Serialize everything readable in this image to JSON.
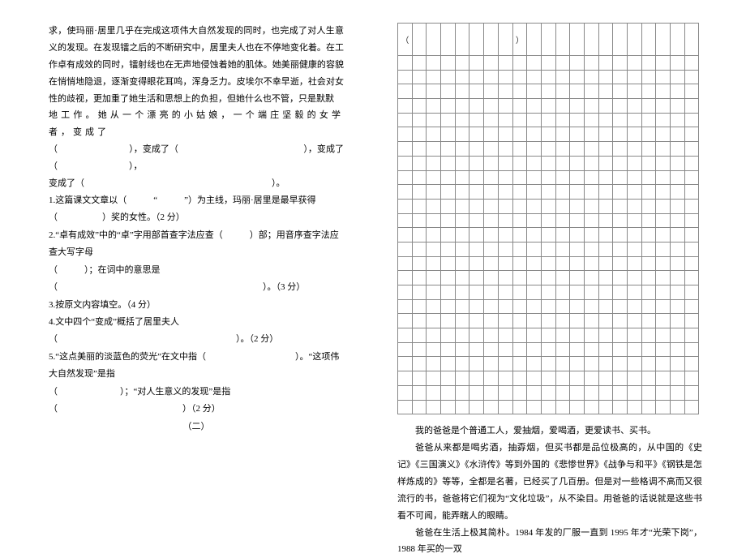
{
  "left": {
    "passage_1": "求，使玛丽·居里几乎在完成这项伟大自然发现的同时，也完成了对人生意义的发现。在发现镭之后的不断研究中，居里夫人也在不停地变化着。在工作卓有成效的同时，镭射线也在无声地侵蚀着她的肌体。她美丽健康的容貌在悄悄地隐退，逐渐变得眼花耳鸣，浑身乏力。皮埃尔不幸早逝，社会对女性的歧视，更加重了她生活和思想上的负担，但她什么也不管，只是默默",
    "passage_2_spaced": "地工作。她从一个漂亮的小姑娘，一个端庄坚毅的女学者，变成了",
    "passage_3": "（　　　　　　　　），变成了（　　　　　　　　　　　　　　），变成了（　　　　　　　　），",
    "passage_4": "变成了（　　　　　　　　　　　　　　　　　　　　　）。",
    "q1": "1.这篇课文文章以（　　　“　　　”）为主线，玛丽·居里是最早获得（　　　　　）奖的女性。（2 分）",
    "q2a": "2.“卓有成效”中的“卓”字用部首查字法应查（　　　）部；用音序查字法应查大写字母",
    "q2b": "（　　　）；在词中的意思是（　　　　　　　　　　　　　　　　　　　　　　　）。（3 分）",
    "q3": "3.按原文内容填空。（4 分）",
    "q4": "4.文中四个“变成”概括了居里夫人（　　　　　　　　　　　　　　　　　　　　）。（2 分）",
    "q5a": "5.“这点美丽的淡蓝色的荧光”在文中指（　　　　　　　　　　）。“这项伟大自然发现”是指",
    "q5b": "（　　　　　　　）；“对人生意义的发现”是指（　　　　　　　　　　　　　　）（2 分）",
    "section2": "（二）"
  },
  "right": {
    "p1": "我的爸爸是个普通工人，爱抽烟，爱喝酒，更爱读书、买书。",
    "p2": "爸爸从来都是喝劣酒，抽孬烟，但买书都是品位极高的，从中国的《史记》《三国演义》《水浒传》等到外国的《悲惨世界》《战争与和平》《钢铁是怎样炼成的》等等，全都是名著，已经买了几百册。但是对一些格调不高而又很流行的书，爸爸将它们视为“文化垃圾”，从不染目。用爸爸的话说就是这些书看不可闻，能弄瞎人的眼睛。",
    "p3": "爸爸在生活上极其简朴。1984 年发的厂服一直到 1995 年才“光荣下岗”，1988 年买的一双"
  },
  "grid": {
    "first_row_blank": "（",
    "first_row_blank_close": "）",
    "cols": 21,
    "body_rows": 25
  }
}
